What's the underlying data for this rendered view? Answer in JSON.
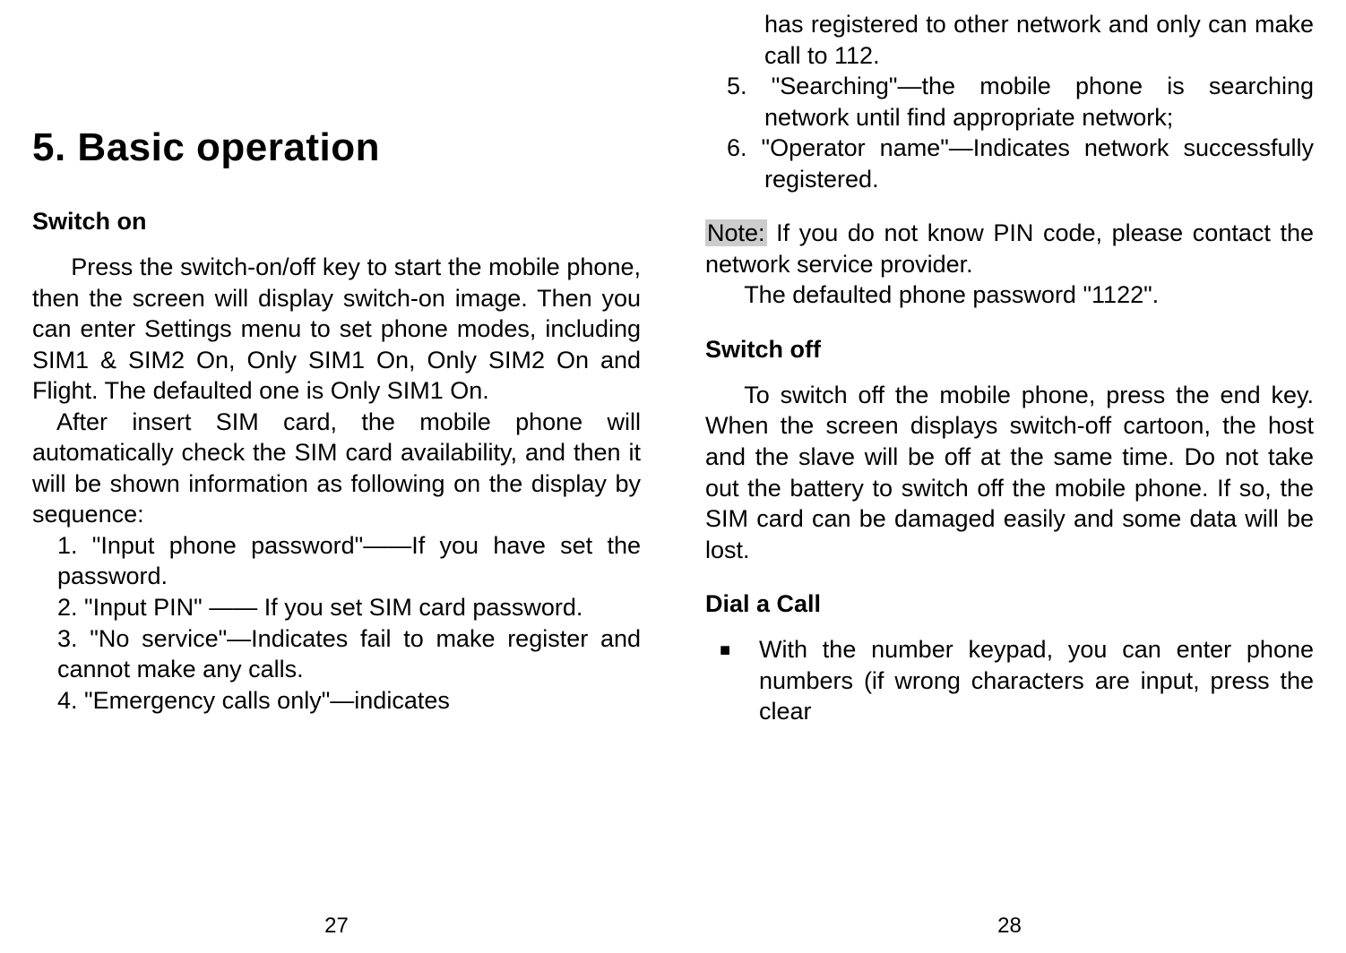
{
  "left": {
    "heading": "5.  Basic operation",
    "sub_switch_on": "Switch on",
    "para1": "Press the switch-on/off key to start the mobile phone, then the screen will display switch-on image. Then you can enter Settings menu to set phone modes, including SIM1 & SIM2 On, Only SIM1 On, Only SIM2 On and Flight. The defaulted one is Only SIM1 On.",
    "para2": "After insert SIM card, the mobile phone will automatically check the SIM card availability, and then it will be shown information as following on the display by sequence:",
    "li1": "1. \"Input phone password\"——If you have set the password.",
    "li2": "2. \"Input PIN\" —— If you set SIM card password.",
    "li3": "3. \"No service\"—Indicates fail to make register and cannot make any calls.",
    "li4": "4. \"Emergency calls only\"—indicates",
    "page_number": "27"
  },
  "right": {
    "li4_cont": "has registered to other network and only can make call to 112.",
    "li5": "5. \"Searching\"—the mobile phone is searching network until find appropriate network;",
    "li6": "6. \"Operator name\"—Indicates network successfully registered.",
    "note_label": "Note:",
    "note_body": " If you do not know PIN code, please contact the network service provider.",
    "note_para2": "The defaulted phone password \"1122\".",
    "sub_switch_off": "Switch off",
    "switch_off_body": "To switch off the mobile phone, press the end key. When the screen displays switch-off cartoon, the host and the slave will be off at the same time. Do not take out the battery to switch off the mobile phone. If so, the SIM card can be damaged easily and some data will be lost.",
    "sub_dial": "Dial a Call",
    "bullet_symbol": "■",
    "bullet_body": "With the number keypad, you can enter phone numbers (if wrong characters are input, press the clear",
    "page_number": "28"
  }
}
